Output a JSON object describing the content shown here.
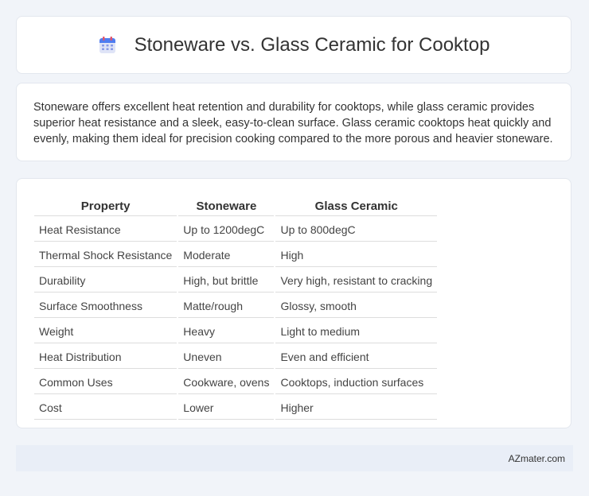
{
  "header": {
    "icon": "calendar-icon",
    "title": "Stoneware vs. Glass Ceramic for Cooktop"
  },
  "intro": {
    "text": "Stoneware offers excellent heat retention and durability for cooktops, while glass ceramic provides superior heat resistance and a sleek, easy-to-clean surface. Glass ceramic cooktops heat quickly and evenly, making them ideal for precision cooking compared to the more porous and heavier stoneware."
  },
  "table": {
    "headers": [
      "Property",
      "Stoneware",
      "Glass Ceramic"
    ],
    "rows": [
      [
        "Heat Resistance",
        "Up to 1200degC",
        "Up to 800degC"
      ],
      [
        "Thermal Shock Resistance",
        "Moderate",
        "High"
      ],
      [
        "Durability",
        "High, but brittle",
        "Very high, resistant to cracking"
      ],
      [
        "Surface Smoothness",
        "Matte/rough",
        "Glossy, smooth"
      ],
      [
        "Weight",
        "Heavy",
        "Light to medium"
      ],
      [
        "Heat Distribution",
        "Uneven",
        "Even and efficient"
      ],
      [
        "Common Uses",
        "Cookware, ovens",
        "Cooktops, induction surfaces"
      ],
      [
        "Cost",
        "Lower",
        "Higher"
      ]
    ]
  },
  "footer": {
    "credit": "AZmater.com"
  }
}
